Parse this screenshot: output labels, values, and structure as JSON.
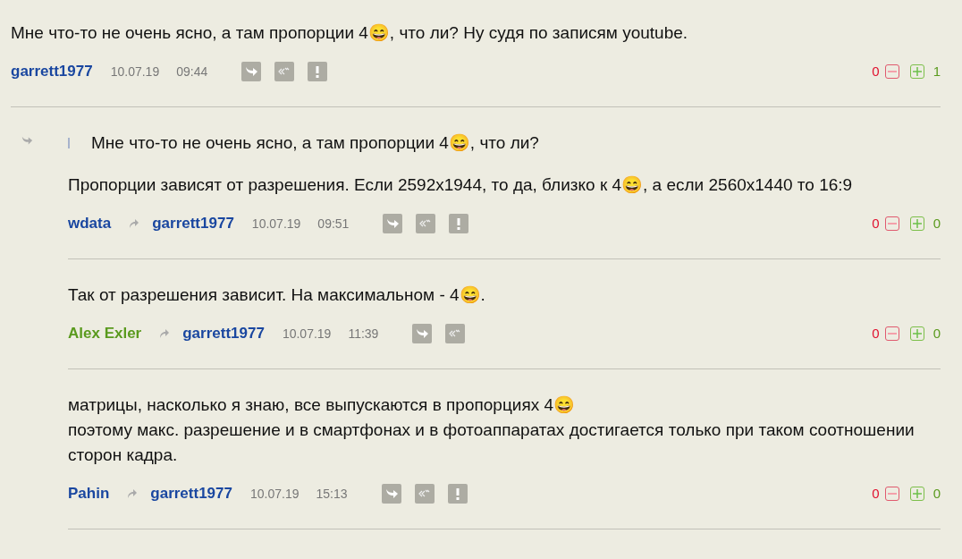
{
  "comments": [
    {
      "nested": false,
      "text": "Мне что-то не очень ясно, а там пропорции 4😄, что ли? Ну судя по записям youtube.",
      "author": {
        "name": "garrett1977",
        "color": "#1a47a0"
      },
      "date": "10.07.19",
      "time": "09:44",
      "reportable": true,
      "minus": "0",
      "plus": "1"
    },
    {
      "nested": true,
      "quote": "Мне что-то не очень ясно, а там пропорции 4😄, что ли?",
      "text": "Пропорции зависят от разрешения. Если 2592x1944, то да, близко к 4😄, а если 2560x1440 то 16:9",
      "author": {
        "name": "wdata",
        "color": "#1a47a0"
      },
      "reply_to": "garrett1977",
      "date": "10.07.19",
      "time": "09:51",
      "reportable": true,
      "minus": "0",
      "plus": "0"
    },
    {
      "nested": true,
      "text": "Так от разрешения зависит. На максимальном - 4😄.",
      "author": {
        "name": "Alex Exler",
        "color": "#5a9a1e"
      },
      "reply_to": "garrett1977",
      "date": "10.07.19",
      "time": "11:39",
      "reportable": false,
      "minus": "0",
      "plus": "0"
    },
    {
      "nested": true,
      "text": "матрицы, насколько я знаю, все выпускаются в пропорциях 4😄\nпоэтому макс. разрешение и в смартфонах и в фотоаппаратах достигается только при таком соотношении сторон кадра.",
      "author": {
        "name": "Pahin",
        "color": "#1a47a0"
      },
      "reply_to": "garrett1977",
      "date": "10.07.19",
      "time": "15:13",
      "reportable": true,
      "minus": "0",
      "plus": "0"
    }
  ]
}
